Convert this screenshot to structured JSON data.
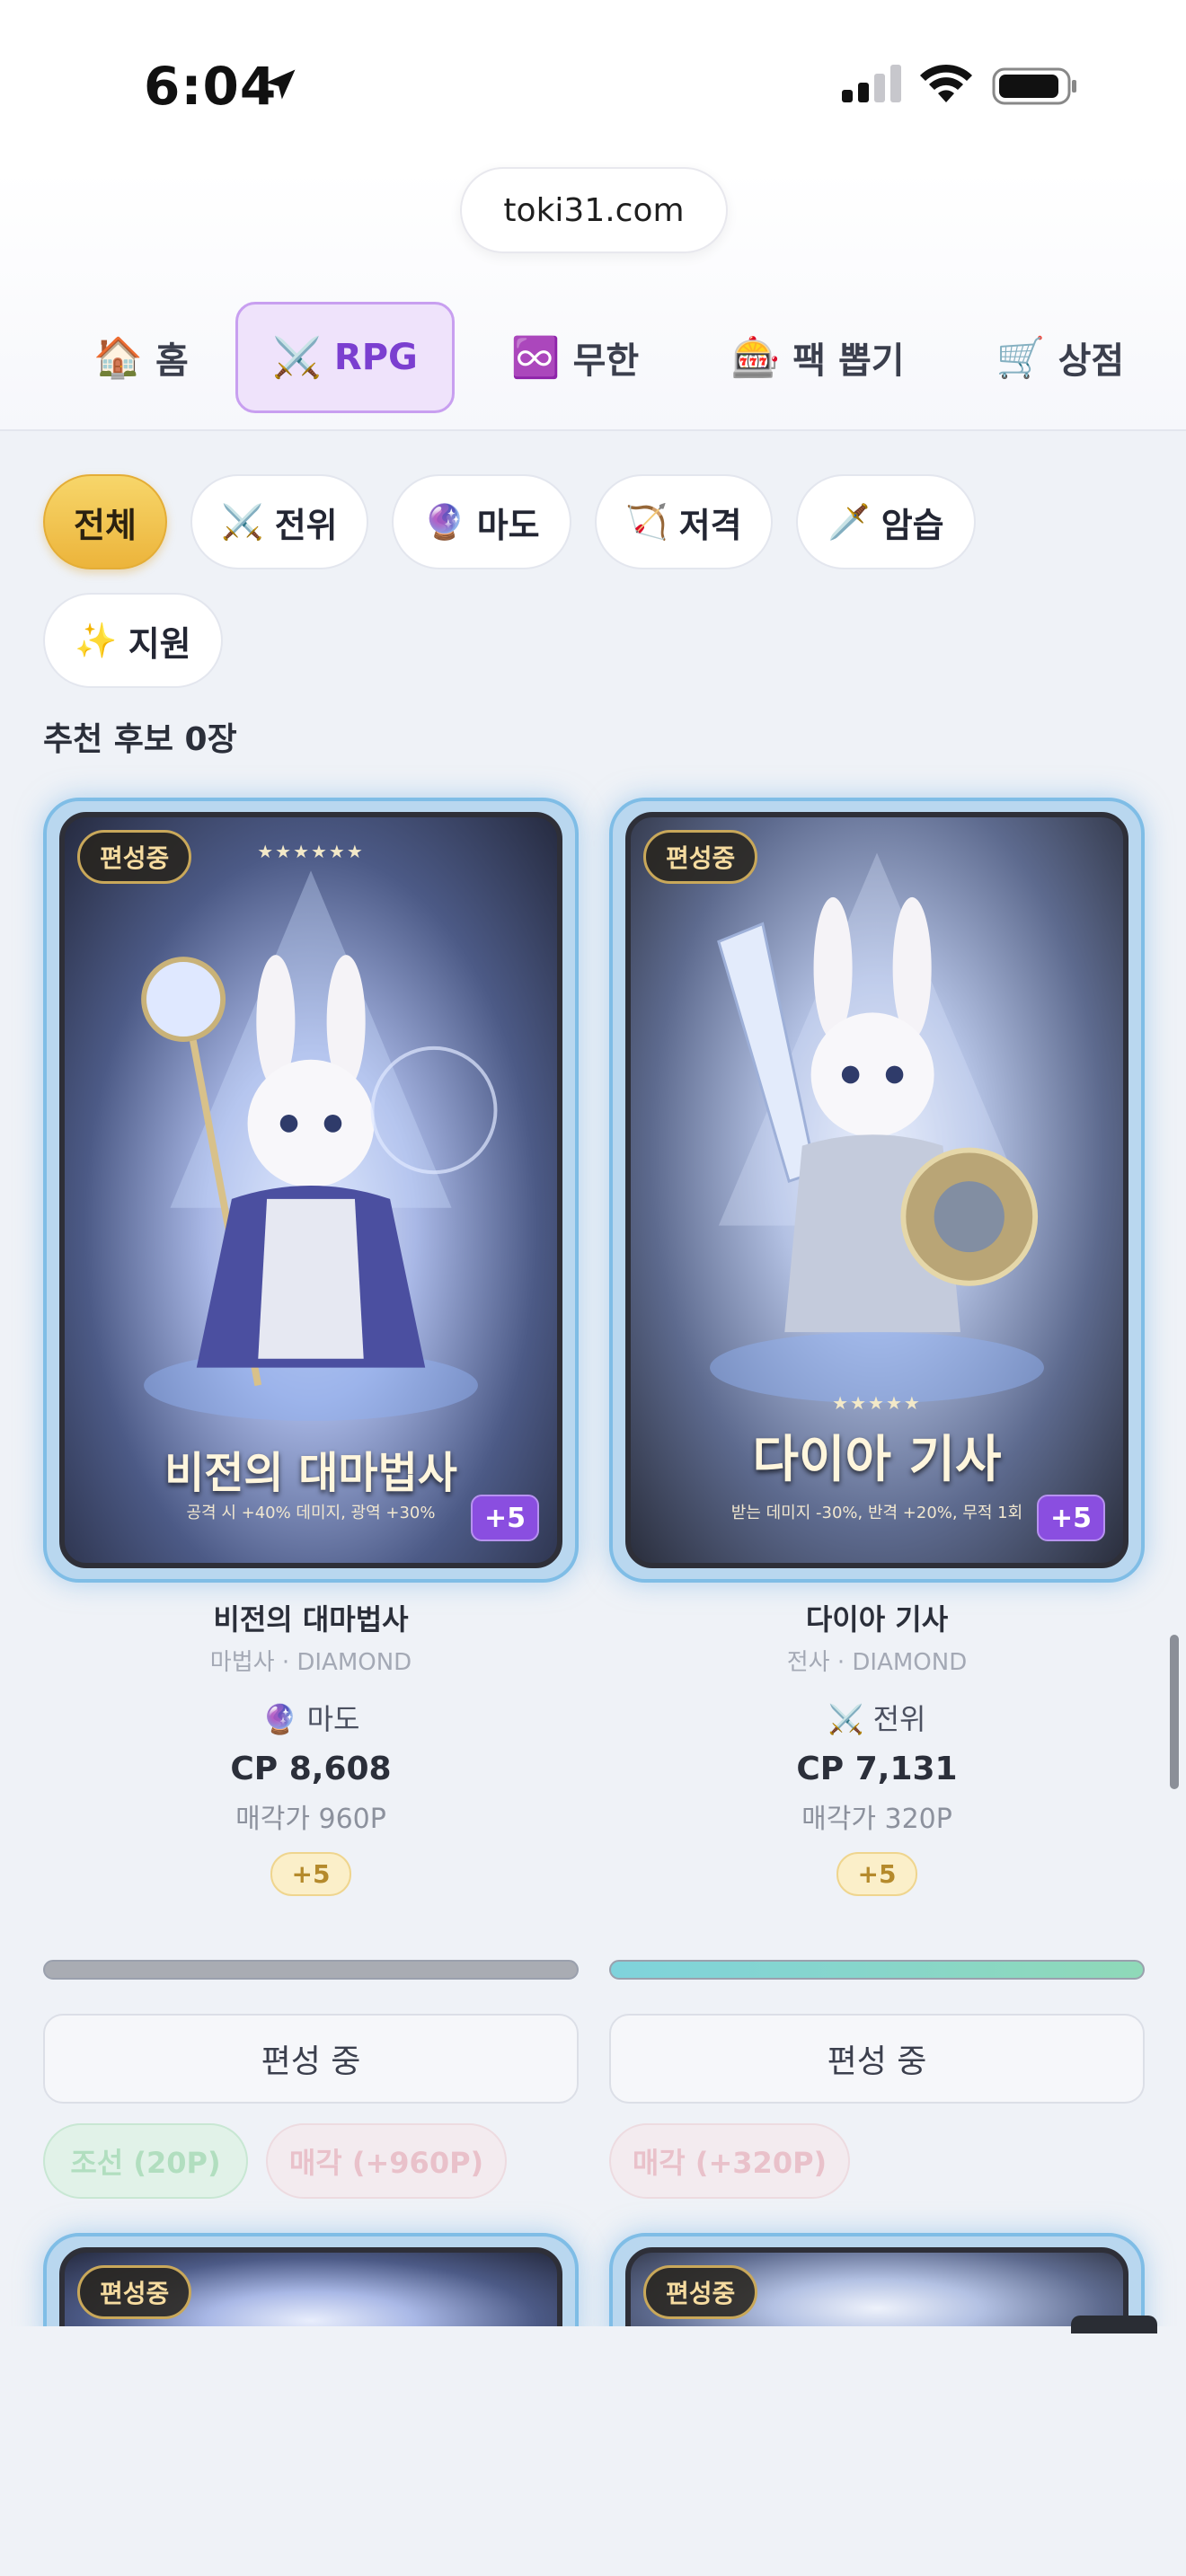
{
  "status_bar": {
    "time": "6:04"
  },
  "browser": {
    "url": "toki31.com"
  },
  "nav": {
    "items": [
      {
        "icon": "🏠",
        "label": "홈"
      },
      {
        "icon": "⚔️",
        "label": "RPG"
      },
      {
        "icon": "♾️",
        "label": "무한"
      },
      {
        "icon": "🎰",
        "label": "팩 뽑기"
      },
      {
        "icon": "🛒",
        "label": "상점"
      }
    ]
  },
  "filters": [
    {
      "icon": "",
      "label": "전체"
    },
    {
      "icon": "⚔️",
      "label": "전위"
    },
    {
      "icon": "🔮",
      "label": "마도"
    },
    {
      "icon": "🏹",
      "label": "저격"
    },
    {
      "icon": "🗡️",
      "label": "암습"
    },
    {
      "icon": "✨",
      "label": "지원"
    }
  ],
  "section_title": "추천 후보 0장",
  "cards": [
    {
      "badge": "편성중",
      "art_title": "비전의 대마법사",
      "art_subtitle": "공격 시 +40% 데미지, 광역 +30%",
      "plus": "+5",
      "name": "비전의 대마법사",
      "class_line": "마법사 · DIAMOND",
      "role_icon": "🔮",
      "role": "마도",
      "cp": "CP 8,608",
      "sell_price": "매각가 960P",
      "level_pill": "+5",
      "progress": 1.0,
      "editing_button": "편성 중",
      "equip_button": "조선 (20P)",
      "sell_button": "매각 (+960P)"
    },
    {
      "badge": "편성중",
      "art_title": "다이아 기사",
      "art_subtitle": "받는 데미지 -30%, 반격 +20%, 무적 1회",
      "plus": "+5",
      "name": "다이아 기사",
      "class_line": "전사 · DIAMOND",
      "role_icon": "⚔️",
      "role": "전위",
      "cp": "CP 7,131",
      "sell_price": "매각가 320P",
      "level_pill": "+5",
      "progress": 1.0,
      "editing_button": "편성 중",
      "sell_button": "매각 (+320P)"
    }
  ],
  "next_row_badges": [
    "편성중",
    "편성중"
  ],
  "colors": {
    "accent_purple": "#7b3fd0",
    "chip_active": "#ecb43b",
    "card_border": "#7fbde6",
    "progress_teal": "#7fd3dc"
  }
}
